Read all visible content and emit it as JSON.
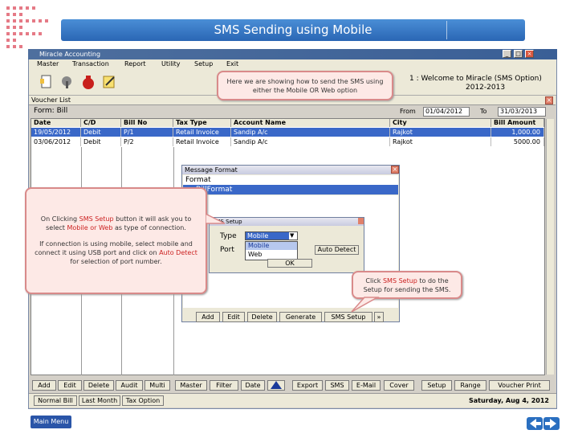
{
  "banner": {
    "title": "SMS Sending using Mobile"
  },
  "app": {
    "title": "Miracle Accounting",
    "menus": [
      "Master",
      "Transaction",
      "Report",
      "Utility",
      "Setup",
      "Exit"
    ],
    "welcome": "1 : Welcome to Miracle (SMS Option)",
    "year": "2012-2013"
  },
  "callouts": {
    "top": "Here we are showing how to send the SMS using either the Mobile OR Web option",
    "left_p1_a": "On Clicking ",
    "left_p1_b": "SMS Setup",
    "left_p1_c": " button it will ask you to select ",
    "left_p1_d": "Mobile or Web",
    "left_p1_e": " as type of connection.",
    "left_p2_a": "If connection is using mobile, select mobile and connect it using USB port and click on ",
    "left_p2_b": "Auto Detect",
    "left_p2_c": " for selection of port number.",
    "right_a": "Click ",
    "right_b": "SMS Setup",
    "right_c": " to do the Setup for sending the SMS."
  },
  "voucher_list": {
    "title": "Voucher List",
    "form_label": "Form: Bill",
    "from_label": "From",
    "from_value": "01/04/2012",
    "to_label": "To",
    "to_value": "31/03/2013",
    "columns": [
      "Date",
      "C/D",
      "Bill No",
      "Tax Type",
      "Account Name",
      "City",
      "Bill Amount"
    ],
    "rows": [
      [
        "19/05/2012",
        "Debit",
        "P/1",
        "Retail Invoice",
        "Sandip A/c",
        "Rajkot",
        "1,000.00"
      ],
      [
        "03/06/2012",
        "Debit",
        "P/2",
        "Retail Invoice",
        "Sandip A/c",
        "Rajkot",
        "5000.00"
      ]
    ],
    "bottom_buttons": [
      "Add",
      "Edit",
      "Delete",
      "Audit",
      "Multi",
      "Master",
      "Filter",
      "Date",
      "Export",
      "SMS",
      "E-Mail",
      "Cover",
      "Setup",
      "Range",
      "Voucher Print"
    ],
    "status_buttons": [
      "Normal Bill",
      "Last Month",
      "Tax Option"
    ],
    "status_date": "Saturday, Aug 4, 2012"
  },
  "message_format": {
    "title": "Message Format",
    "items": [
      "Format",
      "BillFormat"
    ],
    "buttons": [
      "Add",
      "Edit",
      "Delete",
      "Generate",
      "SMS Setup"
    ]
  },
  "sms_setup": {
    "title": "SMS Setup",
    "type_label": "Type",
    "type_value": "Mobile",
    "port_label": "Port",
    "port_value": "",
    "options": [
      "Mobile",
      "Web"
    ],
    "auto_detect": "Auto Detect",
    "ok": "OK"
  },
  "footer": {
    "main_menu": "Main Menu"
  },
  "colors": {
    "banner": "#3a7ac8",
    "callout_border": "#d98a8a",
    "highlight": "#cc2222",
    "selection": "#3a68c8"
  }
}
